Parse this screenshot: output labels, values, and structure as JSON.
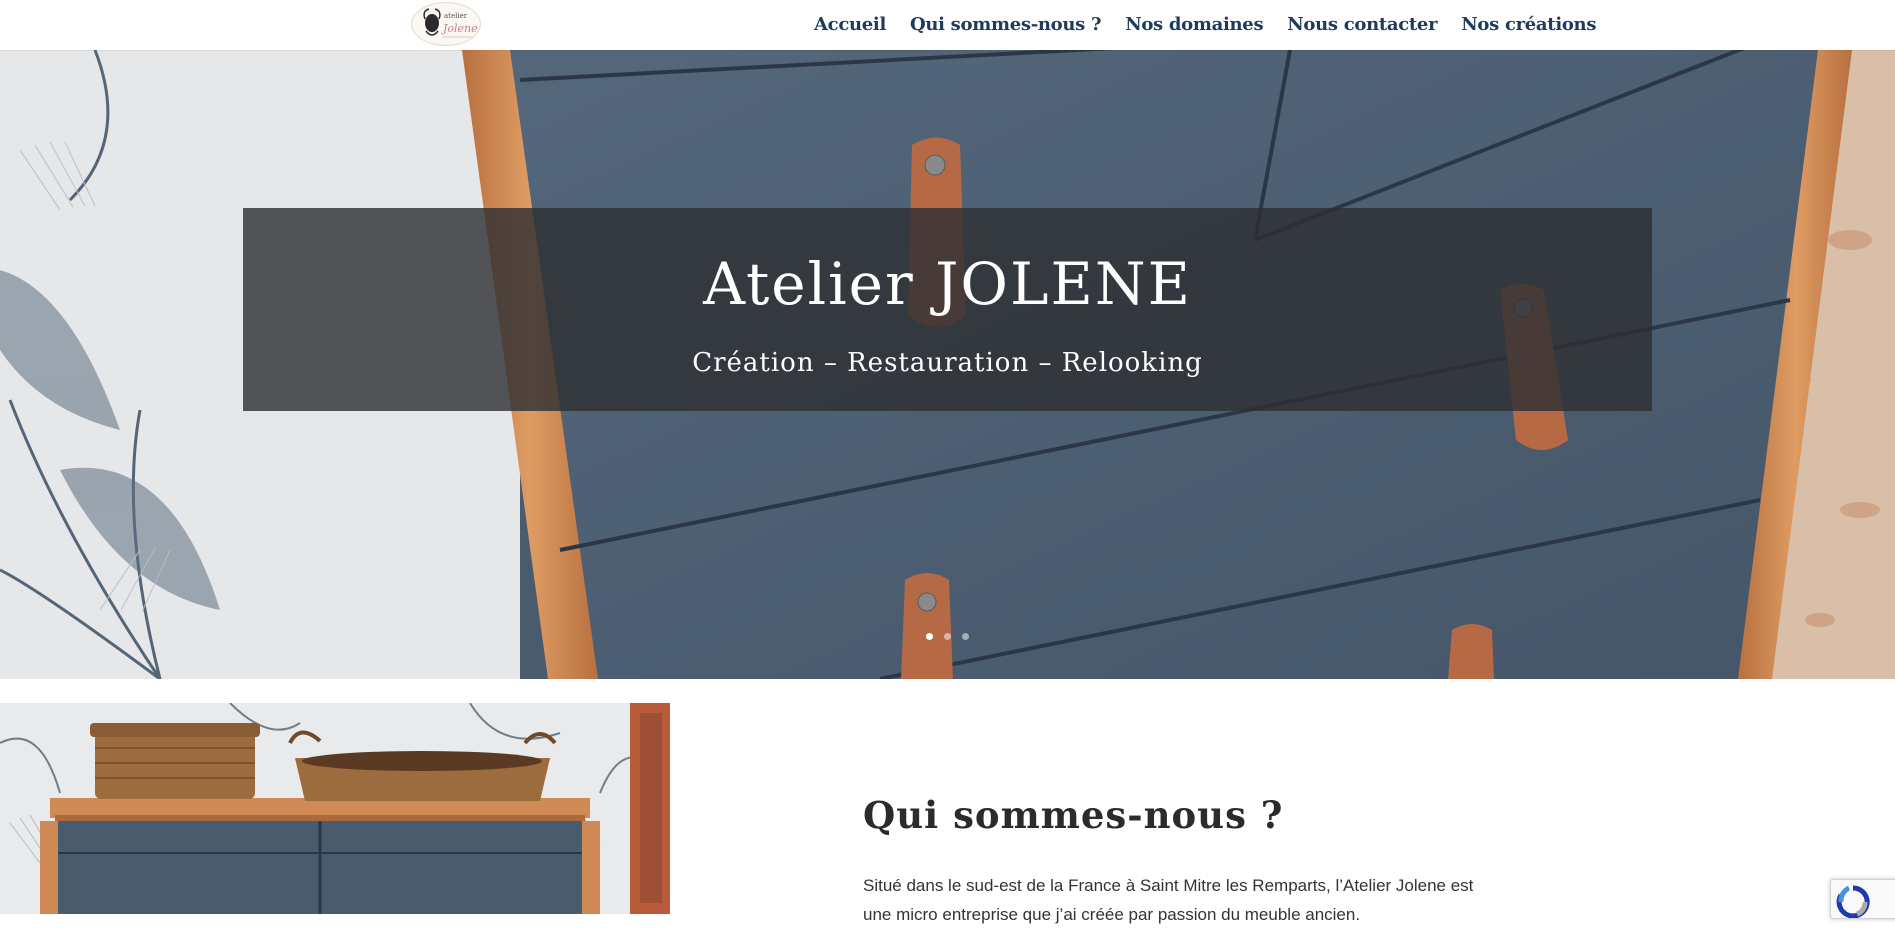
{
  "header": {
    "logo": {
      "icon": "atelier-jolene-logo",
      "lines": [
        "atelier",
        "Jolene"
      ]
    },
    "nav": [
      {
        "label": "Accueil"
      },
      {
        "label": "Qui sommes-nous ?"
      },
      {
        "label": "Nos domaines"
      },
      {
        "label": "Nous contacter"
      },
      {
        "label": "Nos créations"
      }
    ]
  },
  "hero": {
    "title": "Atelier JOLENE",
    "subtitle": "Création – Restauration – Relooking",
    "slides_count": 3,
    "active_slide": 1
  },
  "about": {
    "heading": "Qui sommes-nous ?",
    "text": "Situé dans le sud-est de la France à Saint Mitre les Remparts, l’Atelier Jolene est une micro entreprise que j’ai créée par passion du meuble ancien."
  },
  "colors": {
    "nav_text": "#1e3a5c",
    "caption_bg": "#2d2e32",
    "drawer_blue": "#4c5e71",
    "leather": "#b56a45",
    "wood": "#cf8a55"
  }
}
